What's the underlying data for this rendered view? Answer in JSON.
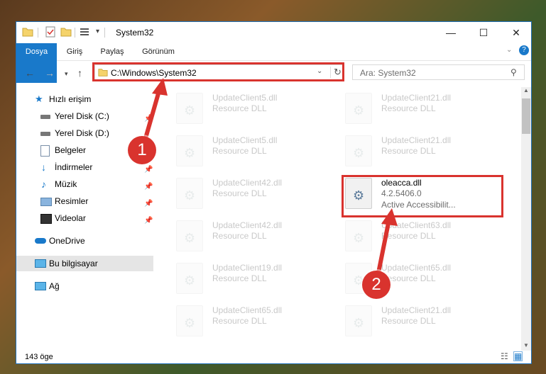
{
  "window": {
    "title": "System32",
    "controls": {
      "minimize": "—",
      "maximize": "☐",
      "close": "✕"
    }
  },
  "ribbon": {
    "tabs": [
      "Dosya",
      "Giriş",
      "Paylaş",
      "Görünüm"
    ],
    "help": "?"
  },
  "address": {
    "path": "C:\\Windows\\System32",
    "search_placeholder": "Ara: System32"
  },
  "sidebar": {
    "items": [
      {
        "label": "Hızlı erişim",
        "icon": "star-icon"
      },
      {
        "label": "Yerel Disk (C:)",
        "icon": "drive-icon"
      },
      {
        "label": "Yerel Disk (D:)",
        "icon": "drive-icon"
      },
      {
        "label": "Belgeler",
        "icon": "documents-icon"
      },
      {
        "label": "İndirmeler",
        "icon": "download-icon"
      },
      {
        "label": "Müzik",
        "icon": "music-icon"
      },
      {
        "label": "Resimler",
        "icon": "pictures-icon"
      },
      {
        "label": "Videolar",
        "icon": "videos-icon"
      },
      {
        "label": "OneDrive",
        "icon": "cloud-icon"
      },
      {
        "label": "Bu bilgisayar",
        "icon": "computer-icon"
      },
      {
        "label": "Ağ",
        "icon": "network-icon"
      }
    ]
  },
  "files": [
    {
      "name": "UpdateClient5.dll",
      "type": "Resource DLL"
    },
    {
      "name": "UpdateClient21.dll",
      "type": "Resource DLL"
    },
    {
      "name": "UpdateClient5.dll",
      "type": "Resource DLL"
    },
    {
      "name": "UpdateClient21.dll",
      "type": "Resource DLL"
    },
    {
      "name": "UpdateClient42.dll",
      "type": "Resource DLL"
    },
    {
      "name": "oleacca.dll",
      "type": "4.2.5406.0",
      "desc": "Active Accessibilit..."
    },
    {
      "name": "UpdateClient42.dll",
      "type": "Resource DLL"
    },
    {
      "name": "UpdateClient63.dll",
      "type": "Resource DLL"
    },
    {
      "name": "UpdateClient19.dll",
      "type": "Resource DLL"
    },
    {
      "name": "UpdateClient65.dll",
      "type": "Resource DLL"
    },
    {
      "name": "UpdateClient65.dll",
      "type": "Resource DLL"
    },
    {
      "name": "UpdateClient21.dll",
      "type": "Resource DLL"
    }
  ],
  "status": {
    "count": "143 öge"
  },
  "annotations": {
    "step1": "1",
    "step2": "2"
  },
  "colors": {
    "accent": "#1979ca",
    "highlight": "#d9332e"
  }
}
